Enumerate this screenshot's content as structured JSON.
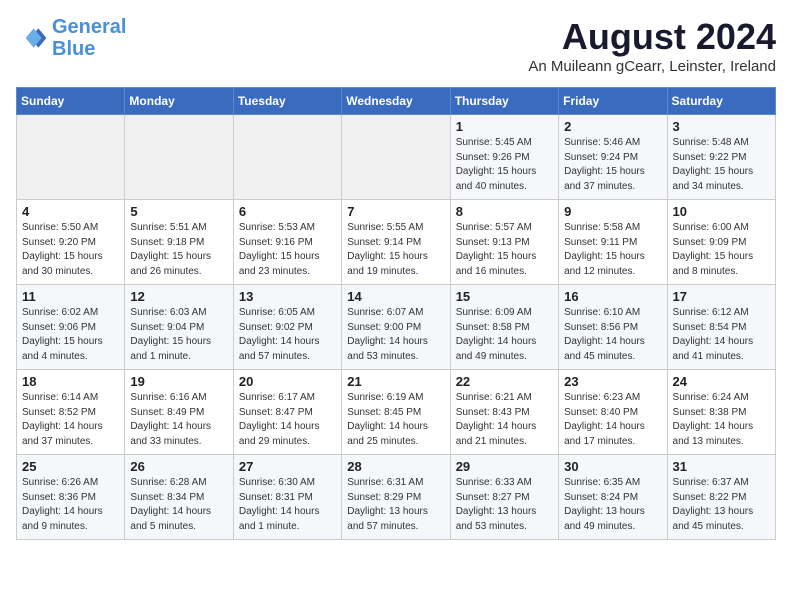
{
  "header": {
    "logo_line1": "General",
    "logo_line2": "Blue",
    "month": "August 2024",
    "location": "An Muileann gCearr, Leinster, Ireland"
  },
  "weekdays": [
    "Sunday",
    "Monday",
    "Tuesday",
    "Wednesday",
    "Thursday",
    "Friday",
    "Saturday"
  ],
  "weeks": [
    [
      {
        "day": "",
        "info": ""
      },
      {
        "day": "",
        "info": ""
      },
      {
        "day": "",
        "info": ""
      },
      {
        "day": "",
        "info": ""
      },
      {
        "day": "1",
        "info": "Sunrise: 5:45 AM\nSunset: 9:26 PM\nDaylight: 15 hours\nand 40 minutes."
      },
      {
        "day": "2",
        "info": "Sunrise: 5:46 AM\nSunset: 9:24 PM\nDaylight: 15 hours\nand 37 minutes."
      },
      {
        "day": "3",
        "info": "Sunrise: 5:48 AM\nSunset: 9:22 PM\nDaylight: 15 hours\nand 34 minutes."
      }
    ],
    [
      {
        "day": "4",
        "info": "Sunrise: 5:50 AM\nSunset: 9:20 PM\nDaylight: 15 hours\nand 30 minutes."
      },
      {
        "day": "5",
        "info": "Sunrise: 5:51 AM\nSunset: 9:18 PM\nDaylight: 15 hours\nand 26 minutes."
      },
      {
        "day": "6",
        "info": "Sunrise: 5:53 AM\nSunset: 9:16 PM\nDaylight: 15 hours\nand 23 minutes."
      },
      {
        "day": "7",
        "info": "Sunrise: 5:55 AM\nSunset: 9:14 PM\nDaylight: 15 hours\nand 19 minutes."
      },
      {
        "day": "8",
        "info": "Sunrise: 5:57 AM\nSunset: 9:13 PM\nDaylight: 15 hours\nand 16 minutes."
      },
      {
        "day": "9",
        "info": "Sunrise: 5:58 AM\nSunset: 9:11 PM\nDaylight: 15 hours\nand 12 minutes."
      },
      {
        "day": "10",
        "info": "Sunrise: 6:00 AM\nSunset: 9:09 PM\nDaylight: 15 hours\nand 8 minutes."
      }
    ],
    [
      {
        "day": "11",
        "info": "Sunrise: 6:02 AM\nSunset: 9:06 PM\nDaylight: 15 hours\nand 4 minutes."
      },
      {
        "day": "12",
        "info": "Sunrise: 6:03 AM\nSunset: 9:04 PM\nDaylight: 15 hours\nand 1 minute."
      },
      {
        "day": "13",
        "info": "Sunrise: 6:05 AM\nSunset: 9:02 PM\nDaylight: 14 hours\nand 57 minutes."
      },
      {
        "day": "14",
        "info": "Sunrise: 6:07 AM\nSunset: 9:00 PM\nDaylight: 14 hours\nand 53 minutes."
      },
      {
        "day": "15",
        "info": "Sunrise: 6:09 AM\nSunset: 8:58 PM\nDaylight: 14 hours\nand 49 minutes."
      },
      {
        "day": "16",
        "info": "Sunrise: 6:10 AM\nSunset: 8:56 PM\nDaylight: 14 hours\nand 45 minutes."
      },
      {
        "day": "17",
        "info": "Sunrise: 6:12 AM\nSunset: 8:54 PM\nDaylight: 14 hours\nand 41 minutes."
      }
    ],
    [
      {
        "day": "18",
        "info": "Sunrise: 6:14 AM\nSunset: 8:52 PM\nDaylight: 14 hours\nand 37 minutes."
      },
      {
        "day": "19",
        "info": "Sunrise: 6:16 AM\nSunset: 8:49 PM\nDaylight: 14 hours\nand 33 minutes."
      },
      {
        "day": "20",
        "info": "Sunrise: 6:17 AM\nSunset: 8:47 PM\nDaylight: 14 hours\nand 29 minutes."
      },
      {
        "day": "21",
        "info": "Sunrise: 6:19 AM\nSunset: 8:45 PM\nDaylight: 14 hours\nand 25 minutes."
      },
      {
        "day": "22",
        "info": "Sunrise: 6:21 AM\nSunset: 8:43 PM\nDaylight: 14 hours\nand 21 minutes."
      },
      {
        "day": "23",
        "info": "Sunrise: 6:23 AM\nSunset: 8:40 PM\nDaylight: 14 hours\nand 17 minutes."
      },
      {
        "day": "24",
        "info": "Sunrise: 6:24 AM\nSunset: 8:38 PM\nDaylight: 14 hours\nand 13 minutes."
      }
    ],
    [
      {
        "day": "25",
        "info": "Sunrise: 6:26 AM\nSunset: 8:36 PM\nDaylight: 14 hours\nand 9 minutes."
      },
      {
        "day": "26",
        "info": "Sunrise: 6:28 AM\nSunset: 8:34 PM\nDaylight: 14 hours\nand 5 minutes."
      },
      {
        "day": "27",
        "info": "Sunrise: 6:30 AM\nSunset: 8:31 PM\nDaylight: 14 hours\nand 1 minute."
      },
      {
        "day": "28",
        "info": "Sunrise: 6:31 AM\nSunset: 8:29 PM\nDaylight: 13 hours\nand 57 minutes."
      },
      {
        "day": "29",
        "info": "Sunrise: 6:33 AM\nSunset: 8:27 PM\nDaylight: 13 hours\nand 53 minutes."
      },
      {
        "day": "30",
        "info": "Sunrise: 6:35 AM\nSunset: 8:24 PM\nDaylight: 13 hours\nand 49 minutes."
      },
      {
        "day": "31",
        "info": "Sunrise: 6:37 AM\nSunset: 8:22 PM\nDaylight: 13 hours\nand 45 minutes."
      }
    ]
  ]
}
